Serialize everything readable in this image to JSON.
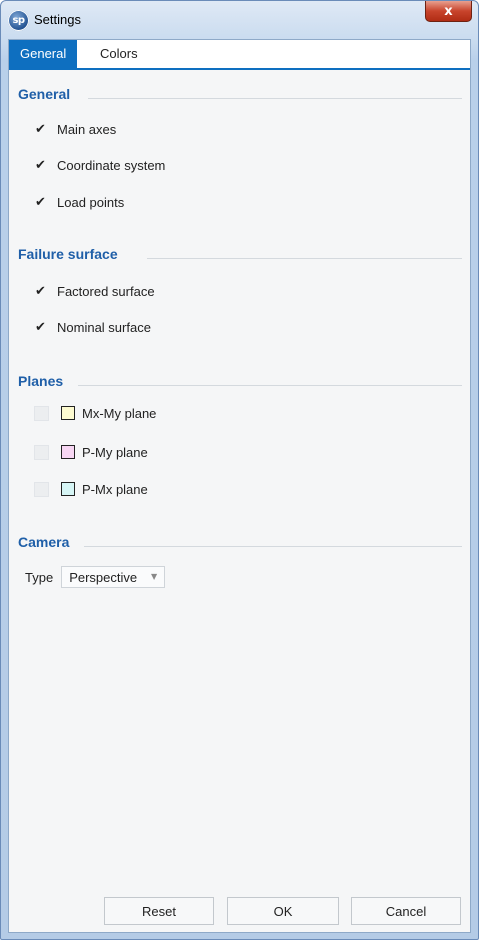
{
  "window": {
    "title": "Settings",
    "icon_text": "sp",
    "close_glyph": "x"
  },
  "tabs": [
    {
      "label": "General",
      "active": true
    },
    {
      "label": "Colors",
      "active": false
    }
  ],
  "sections": {
    "general": {
      "title": "General",
      "items": [
        {
          "label": "Main axes",
          "checked": true
        },
        {
          "label": "Coordinate system",
          "checked": true
        },
        {
          "label": "Load points",
          "checked": true
        }
      ]
    },
    "failure_surface": {
      "title": "Failure surface",
      "items": [
        {
          "label": "Factored surface",
          "checked": true
        },
        {
          "label": "Nominal surface",
          "checked": true
        }
      ]
    },
    "planes": {
      "title": "Planes",
      "items": [
        {
          "label": "Mx-My plane",
          "checked": false,
          "swatch_color": "#fdfbd0"
        },
        {
          "label": "P-My plane",
          "checked": false,
          "swatch_color": "#f7d6f3"
        },
        {
          "label": "P-Mx plane",
          "checked": false,
          "swatch_color": "#d6f5f5"
        }
      ]
    },
    "camera": {
      "title": "Camera",
      "type_label": "Type",
      "type_value": "Perspective"
    }
  },
  "buttons": {
    "reset": "Reset",
    "ok": "OK",
    "cancel": "Cancel"
  },
  "glyphs": {
    "check": "✔",
    "dropdown": "▼"
  },
  "colors": {
    "accent": "#0e6fc0",
    "section_title": "#1f5fa8",
    "close": "#c8442c"
  }
}
